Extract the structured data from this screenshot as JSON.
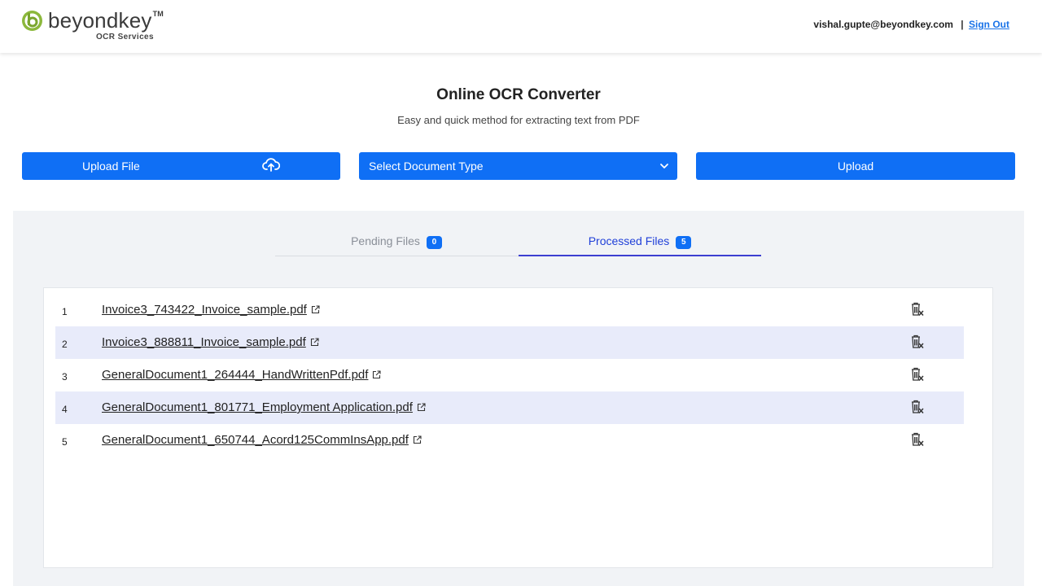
{
  "header": {
    "logo_text": "beyondkey",
    "logo_tm": "TM",
    "logo_subtitle": "OCR Services",
    "user_email": "vishal.gupte@beyondkey.com",
    "separator": "|",
    "sign_out": "Sign Out"
  },
  "main": {
    "title": "Online OCR Converter",
    "subtitle": "Easy and quick method for extracting text from PDF"
  },
  "actions": {
    "upload_file": "Upload File",
    "select_document_type": "Select Document Type",
    "upload": "Upload"
  },
  "tabs": [
    {
      "label": "Pending Files",
      "count": "0"
    },
    {
      "label": "Processed Files",
      "count": "5"
    }
  ],
  "files": [
    {
      "index": "1",
      "name": "Invoice3_743422_Invoice_sample.pdf"
    },
    {
      "index": "2",
      "name": "Invoice3_888811_Invoice_sample.pdf"
    },
    {
      "index": "3",
      "name": "GeneralDocument1_264444_HandWrittenPdf.pdf"
    },
    {
      "index": "4",
      "name": "GeneralDocument1_801771_Employment Application.pdf"
    },
    {
      "index": "5",
      "name": "GeneralDocument1_650744_Acord125CommInsApp.pdf"
    }
  ],
  "colors": {
    "primary": "#0f6ff5",
    "active_tab": "#1f3fd8",
    "row_highlight": "#e8ebfa",
    "logo_green": "#8cb83c"
  }
}
